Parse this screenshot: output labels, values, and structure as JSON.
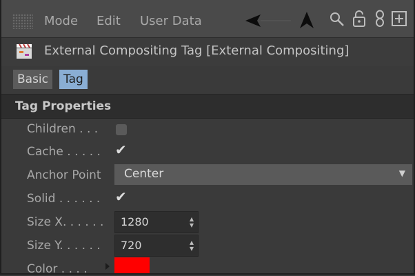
{
  "menubar": {
    "items": [
      "Mode",
      "Edit",
      "User Data"
    ],
    "icons": [
      "back-arrow-icon",
      "cursor-arrow-icon",
      "search-icon",
      "lock-icon",
      "link-icon",
      "new-panel-icon"
    ]
  },
  "title": {
    "text": "External Compositing Tag [External Compositing]",
    "icon": "clapperboard-icon"
  },
  "tabs": [
    {
      "label": "Basic",
      "active": false
    },
    {
      "label": "Tag",
      "active": true
    }
  ],
  "section": {
    "title": "Tag Properties"
  },
  "properties": {
    "children": {
      "label": "Children . . .",
      "checked": false
    },
    "cache": {
      "label": "Cache . . . . .",
      "checked": true
    },
    "anchor_point": {
      "label": "Anchor Point",
      "value": "Center"
    },
    "solid": {
      "label": "Solid . . . . . .",
      "checked": true
    },
    "size_x": {
      "label": "Size X. . . . . .",
      "value": "1280"
    },
    "size_y": {
      "label": "Size Y. . . . . .",
      "value": "720"
    },
    "color": {
      "label": "Color . . . .",
      "value": "#ff0000"
    }
  },
  "colors": {
    "background": "#3a3a3a",
    "active_tab": "#8aaed4",
    "swatch": "#ff0000"
  }
}
